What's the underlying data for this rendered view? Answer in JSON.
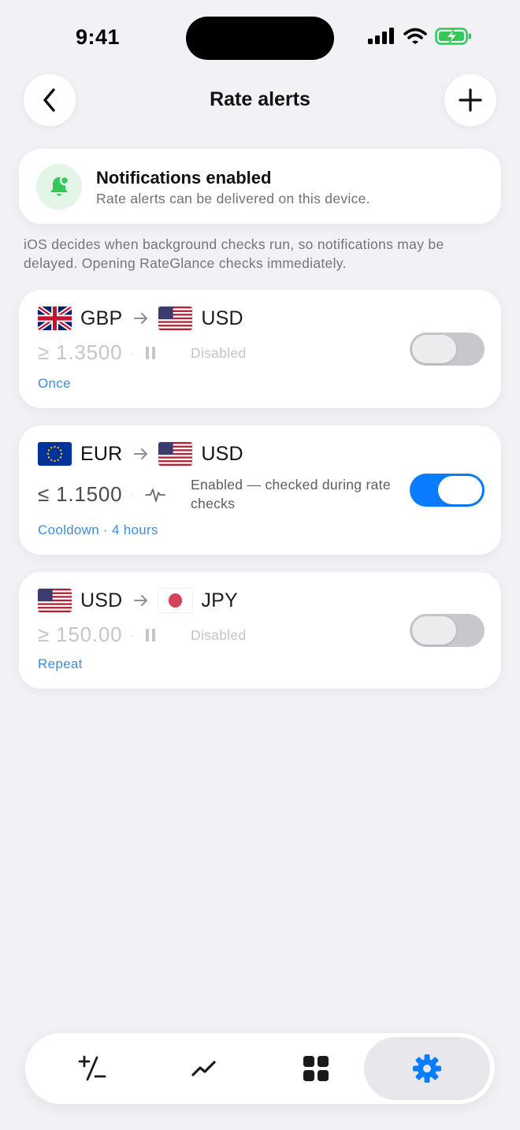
{
  "status_bar": {
    "time": "9:41"
  },
  "header": {
    "title": "Rate alerts",
    "back_icon": "chevron-left-icon",
    "add_icon": "plus-icon"
  },
  "notifications": {
    "title": "Notifications enabled",
    "subtitle": "Rate alerts can be delivered on this device.",
    "icon": "bell-icon",
    "accent": "#34c759"
  },
  "info_text": "iOS decides when background checks run, so notifications may be delayed. Opening RateGlance checks immediately.",
  "alerts": [
    {
      "from": "GBP",
      "to": "USD",
      "threshold": "≥ 1.3500",
      "state_icon": "pause-icon",
      "state": "Disabled",
      "frequency": "Once",
      "enabled": false
    },
    {
      "from": "EUR",
      "to": "USD",
      "threshold": "≤ 1.1500",
      "state_icon": "pulse-icon",
      "state": "Enabled — checked during rate checks",
      "frequency": "Cooldown · 4 hours",
      "enabled": true
    },
    {
      "from": "USD",
      "to": "JPY",
      "threshold": "≥ 150.00",
      "state_icon": "pause-icon",
      "state": "Disabled",
      "frequency": "Repeat",
      "enabled": false
    }
  ],
  "tab_bar": {
    "tabs": [
      {
        "icon": "plus-minus-icon",
        "active": false
      },
      {
        "icon": "chart-line-icon",
        "active": false
      },
      {
        "icon": "grid-icon",
        "active": false
      },
      {
        "icon": "gear-icon",
        "active": true
      }
    ],
    "active_color": "#0a7cff"
  }
}
